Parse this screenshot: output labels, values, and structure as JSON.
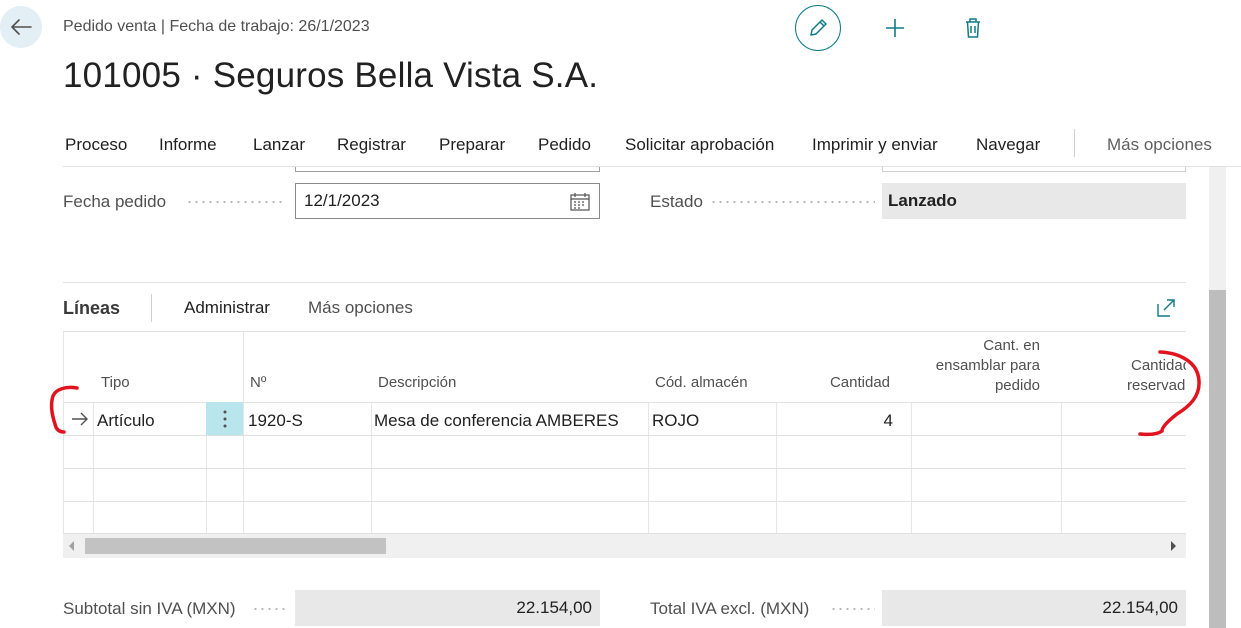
{
  "header": {
    "subtitle": "Pedido venta | Fecha de trabajo: 26/1/2023",
    "title": "101005 · Seguros Bella Vista S.A."
  },
  "menu": {
    "items": [
      "Proceso",
      "Informe",
      "Lanzar",
      "Registrar",
      "Preparar",
      "Pedido",
      "Solicitar aprobación",
      "Imprimir y enviar",
      "Navegar"
    ],
    "more": "Más opciones"
  },
  "fields": {
    "order_date_label": "Fecha pedido",
    "order_date_value": "12/1/2023",
    "status_label": "Estado",
    "status_value": "Lanzado"
  },
  "lines": {
    "title": "Líneas",
    "manage": "Administrar",
    "more": "Más opciones",
    "headers": {
      "tipo": "Tipo",
      "no": "Nº",
      "descripcion": "Descripción",
      "almacen": "Cód. almacén",
      "cantidad": "Cantidad",
      "cant_ensamblar_1": "Cant. en",
      "cant_ensamblar_2": "ensamblar para",
      "cant_ensamblar_3": "pedido",
      "cant_reservada_1": "Cantidad",
      "cant_reservada_2": "reservada"
    },
    "rows": [
      {
        "tipo": "Artículo",
        "no": "1920-S",
        "descripcion": "Mesa de conferencia AMBERES",
        "almacen": "ROJO",
        "cantidad": "4"
      }
    ]
  },
  "totals": {
    "subtotal_label": "Subtotal sin IVA (MXN)",
    "subtotal_value": "22.154,00",
    "total_label": "Total IVA excl. (MXN)",
    "total_value": "22.154,00"
  },
  "colors": {
    "accent": "#0f7b8a",
    "annotation": "#e0141e"
  },
  "icons": [
    "back-arrow-icon",
    "pencil-icon",
    "plus-icon",
    "trash-icon",
    "calendar-icon",
    "expand-icon",
    "row-arrow-icon",
    "kebab-icon"
  ]
}
